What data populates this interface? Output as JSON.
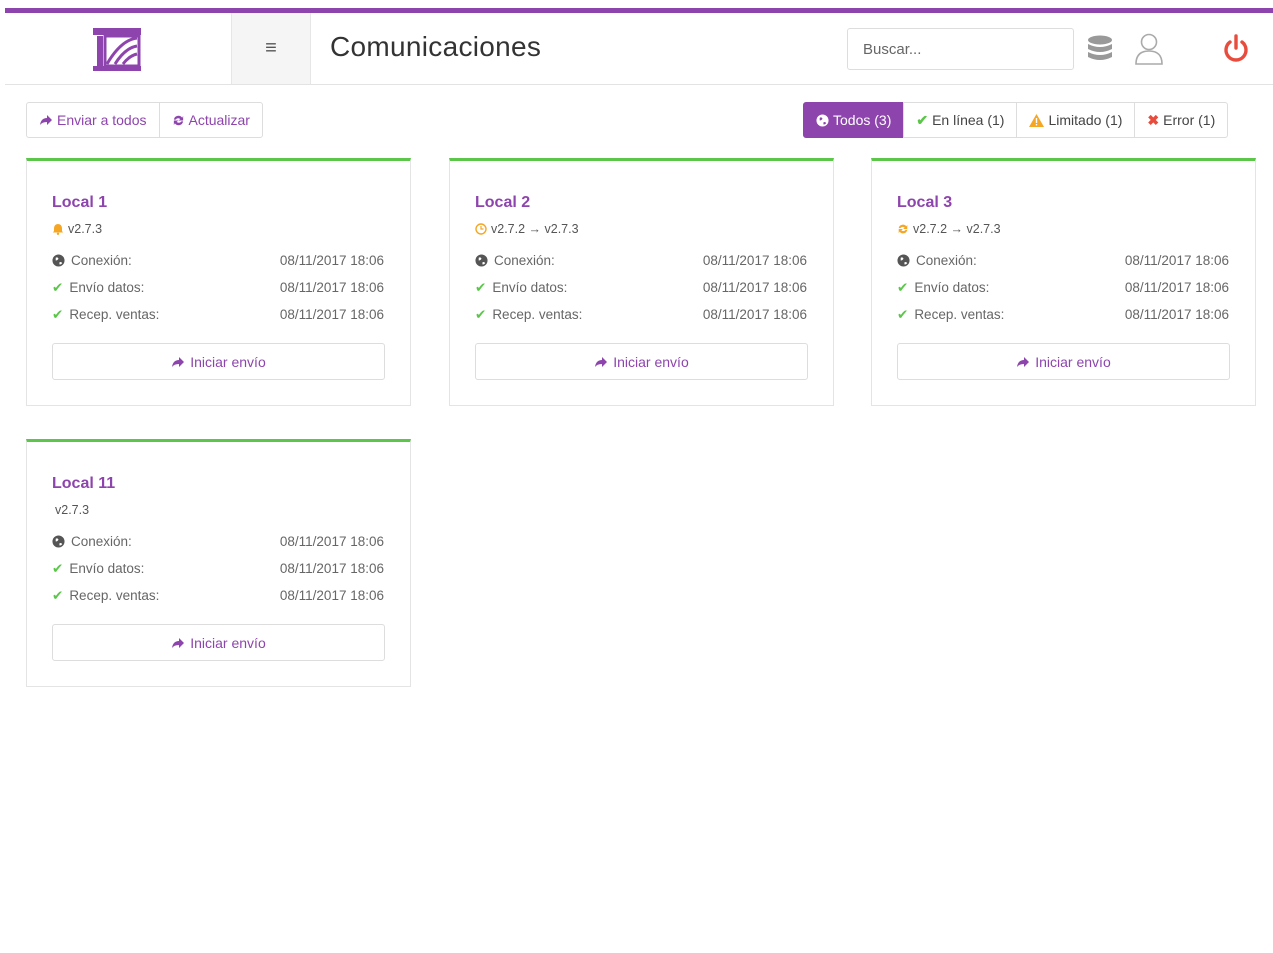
{
  "header": {
    "title": "Comunicaciones",
    "menu_icon": "hamburger-icon",
    "search_placeholder": "Buscar...",
    "icons": [
      "database-icon",
      "user-icon",
      "power-icon"
    ]
  },
  "toolbar": {
    "send_all": "Enviar a todos",
    "refresh": "Actualizar"
  },
  "filters": {
    "all": "Todos (3)",
    "online": "En línea (1)",
    "limited": "Limitado (1)",
    "error": "Error (1)"
  },
  "colors": {
    "brand": "#8e44ad",
    "online": "#5cc64b",
    "warning": "#f5a623",
    "error": "#e74c3c"
  },
  "cards": [
    {
      "title": "Local 1",
      "status_icon": "bell-icon",
      "version": "v2.7.3",
      "rows": [
        {
          "label": "Conexión:",
          "value": "08/11/2017 18:06"
        },
        {
          "label": "Envío datos:",
          "value": "08/11/2017 18:06"
        },
        {
          "label": "Recep. ventas:",
          "value": "08/11/2017 18:06"
        }
      ],
      "button": "Iniciar envío"
    },
    {
      "title": "Local 2",
      "status_icon": "clock-icon",
      "version": "v2.7.2 → v2.7.3",
      "rows": [
        {
          "label": "Conexión:",
          "value": "08/11/2017 18:06"
        },
        {
          "label": "Envío datos:",
          "value": "08/11/2017 18:06"
        },
        {
          "label": "Recep. ventas:",
          "value": "08/11/2017 18:06"
        }
      ],
      "button": "Iniciar envío"
    },
    {
      "title": "Local 3",
      "status_icon": "refresh-icon",
      "version": "v2.7.2 → v2.7.3",
      "rows": [
        {
          "label": "Conexión:",
          "value": "08/11/2017 18:06"
        },
        {
          "label": "Envío datos:",
          "value": "08/11/2017 18:06"
        },
        {
          "label": "Recep. ventas:",
          "value": "08/11/2017 18:06"
        }
      ],
      "button": "Iniciar envío"
    },
    {
      "title": "Local 11",
      "status_icon": "",
      "version": "v2.7.3",
      "rows": [
        {
          "label": "Conexión:",
          "value": "08/11/2017 18:06"
        },
        {
          "label": "Envío datos:",
          "value": "08/11/2017 18:06"
        },
        {
          "label": "Recep. ventas:",
          "value": "08/11/2017 18:06"
        }
      ],
      "button": "Iniciar envío"
    }
  ]
}
